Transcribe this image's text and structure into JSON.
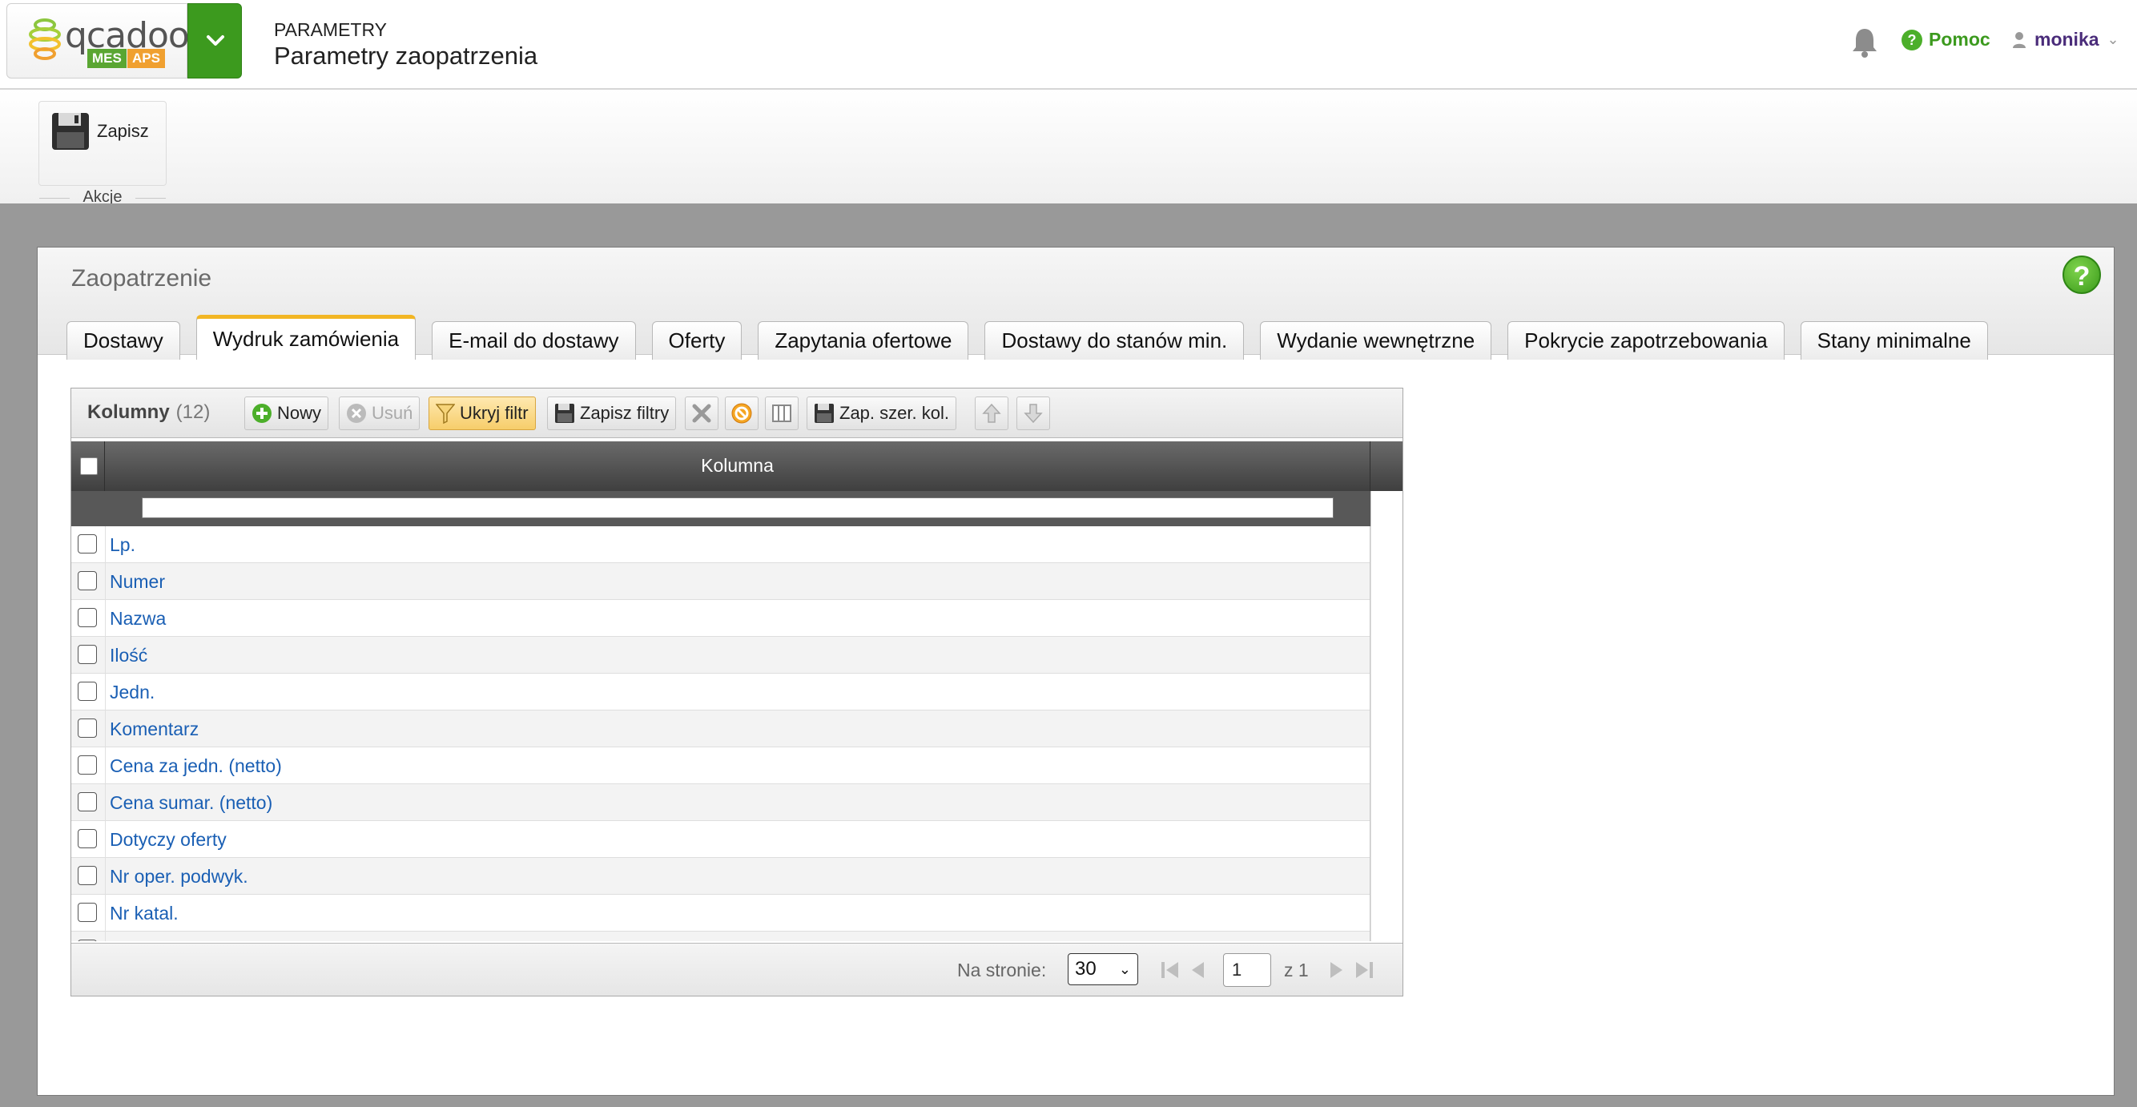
{
  "header": {
    "logo_text": "qcadoo",
    "badge_mes": "MES",
    "badge_aps": "APS",
    "category": "PARAMETRY",
    "title": "Parametry zaopatrzenia",
    "help_label": "Pomoc",
    "user_name": "monika"
  },
  "ribbon": {
    "save_label": "Zapisz",
    "group_label": "Akcje"
  },
  "panel": {
    "title": "Zaopatrzenie",
    "tabs": [
      {
        "label": "Dostawy"
      },
      {
        "label": "Wydruk zamówienia"
      },
      {
        "label": "E-mail do dostawy"
      },
      {
        "label": "Oferty"
      },
      {
        "label": "Zapytania ofertowe"
      },
      {
        "label": "Dostawy do stanów min."
      },
      {
        "label": "Wydanie wewnętrzne"
      },
      {
        "label": "Pokrycie zapotrzebowania"
      },
      {
        "label": "Stany minimalne"
      }
    ],
    "active_tab": "Wydruk zamówienia"
  },
  "grid": {
    "caption": "Kolumny",
    "count": "(12)",
    "toolbar": {
      "new_label": "Nowy",
      "delete_label": "Usuń",
      "hide_filter_label": "Ukryj filtr",
      "save_filters_label": "Zapisz filtry",
      "save_widths_label": "Zap. szer. kol."
    },
    "column_header": "Kolumna",
    "filter_value": "",
    "rows": [
      {
        "label": "Lp."
      },
      {
        "label": "Numer"
      },
      {
        "label": "Nazwa"
      },
      {
        "label": "Ilość"
      },
      {
        "label": "Jedn."
      },
      {
        "label": "Komentarz"
      },
      {
        "label": "Cena za jedn. (netto)"
      },
      {
        "label": "Cena sumar. (netto)"
      },
      {
        "label": "Dotyczy oferty"
      },
      {
        "label": "Nr oper. podwyk."
      },
      {
        "label": "Nr katal."
      }
    ],
    "footer": {
      "per_page_label": "Na stronie:",
      "per_page_value": "30",
      "current_page": "1",
      "total_pages": "z 1"
    }
  },
  "colors": {
    "brand_green": "#3c9a1e",
    "active_tab_accent": "#f2b624",
    "link_blue": "#1a5fb4",
    "user_purple": "#4a2c7a"
  }
}
